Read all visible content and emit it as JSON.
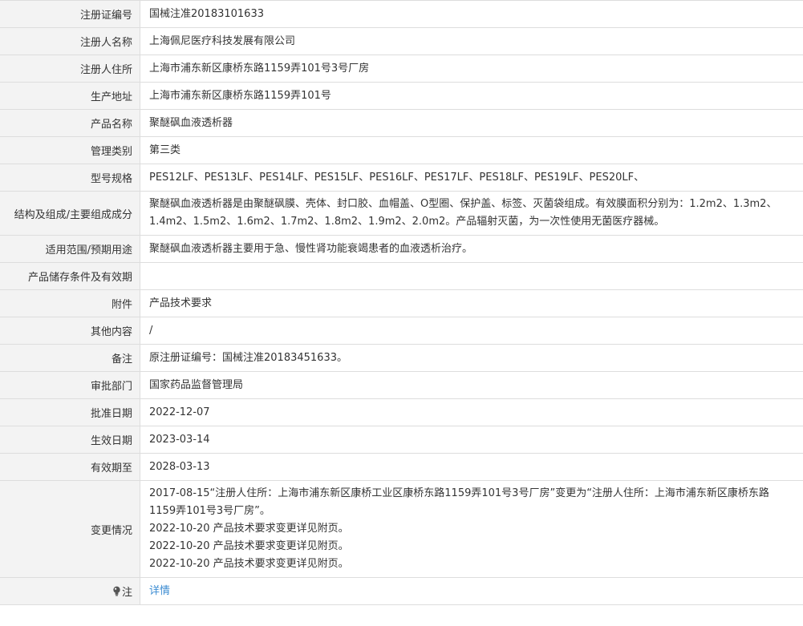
{
  "rows": [
    {
      "label": "注册证编号",
      "value": "国械注准20183101633"
    },
    {
      "label": "注册人名称",
      "value": "上海佩尼医疗科技发展有限公司"
    },
    {
      "label": "注册人住所",
      "value": "上海市浦东新区康桥东路1159弄101号3号厂房"
    },
    {
      "label": "生产地址",
      "value": "上海市浦东新区康桥东路1159弄101号"
    },
    {
      "label": "产品名称",
      "value": "聚醚砜血液透析器"
    },
    {
      "label": "管理类别",
      "value": "第三类"
    },
    {
      "label": "型号规格",
      "value": "PES12LF、PES13LF、PES14LF、PES15LF、PES16LF、PES17LF、PES18LF、PES19LF、PES20LF、"
    },
    {
      "label": "结构及组成/主要组成成分",
      "value": "聚醚砜血液透析器是由聚醚砜膜、壳体、封口胶、血帽盖、O型圈、保护盖、标签、灭菌袋组成。有效膜面积分别为：1.2m2、1.3m2、1.4m2、1.5m2、1.6m2、1.7m2、1.8m2、1.9m2、2.0m2。产品辐射灭菌，为一次性使用无菌医疗器械。"
    },
    {
      "label": "适用范围/预期用途",
      "value": "聚醚砜血液透析器主要用于急、慢性肾功能衰竭患者的血液透析治疗。"
    },
    {
      "label": "产品储存条件及有效期",
      "value": ""
    },
    {
      "label": "附件",
      "value": "产品技术要求"
    },
    {
      "label": "其他内容",
      "value": "/"
    },
    {
      "label": "备注",
      "value": "原注册证编号：国械注准20183451633。"
    },
    {
      "label": "审批部门",
      "value": "国家药品监督管理局"
    },
    {
      "label": "批准日期",
      "value": "2022-12-07"
    },
    {
      "label": "生效日期",
      "value": "2023-03-14"
    },
    {
      "label": "有效期至",
      "value": "2028-03-13"
    }
  ],
  "changes": {
    "label": "变更情况",
    "lines": [
      "2017-08-15“注册人住所：上海市浦东新区康桥工业区康桥东路1159弄101号3号厂房”变更为“注册人住所：上海市浦东新区康桥东路1159弄101号3号厂房”。",
      "2022-10-20 产品技术要求变更详见附页。",
      "2022-10-20 产品技术要求变更详见附页。",
      "2022-10-20 产品技术要求变更详见附页。"
    ]
  },
  "note": {
    "label": "注",
    "icon": "lightbulb-icon",
    "link_text": "详情",
    "link_color": "#3b8cd2"
  }
}
